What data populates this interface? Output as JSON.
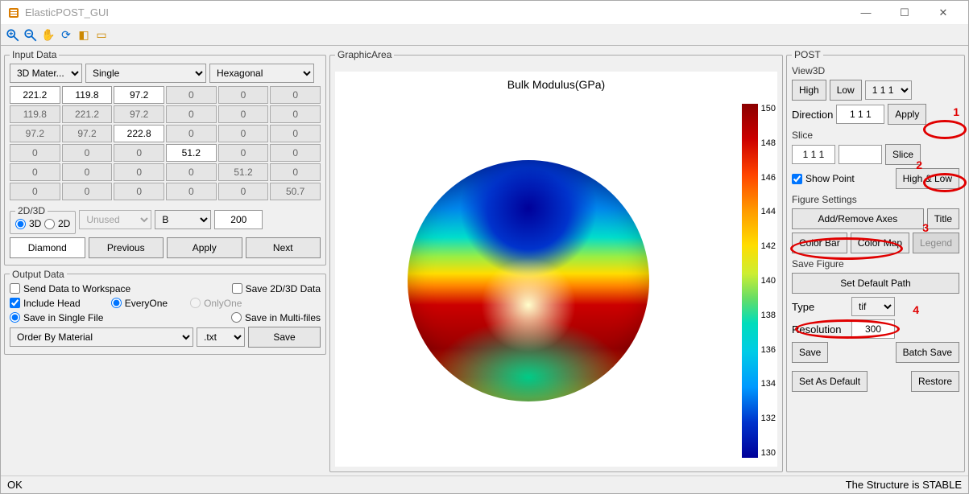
{
  "window": {
    "title": "ElasticPOST_GUI"
  },
  "input": {
    "legend": "Input Data",
    "selects": {
      "dim": "3D Mater...",
      "mode": "Single",
      "sym": "Hexagonal"
    },
    "matrix": [
      [
        {
          "v": "221.2",
          "e": true
        },
        {
          "v": "119.8",
          "e": true
        },
        {
          "v": "97.2",
          "e": true
        },
        {
          "v": "0",
          "e": false
        },
        {
          "v": "0",
          "e": false
        },
        {
          "v": "0",
          "e": false
        }
      ],
      [
        {
          "v": "119.8",
          "e": false
        },
        {
          "v": "221.2",
          "e": false
        },
        {
          "v": "97.2",
          "e": false
        },
        {
          "v": "0",
          "e": false
        },
        {
          "v": "0",
          "e": false
        },
        {
          "v": "0",
          "e": false
        }
      ],
      [
        {
          "v": "97.2",
          "e": false
        },
        {
          "v": "97.2",
          "e": false
        },
        {
          "v": "222.8",
          "e": true
        },
        {
          "v": "0",
          "e": false
        },
        {
          "v": "0",
          "e": false
        },
        {
          "v": "0",
          "e": false
        }
      ],
      [
        {
          "v": "0",
          "e": false
        },
        {
          "v": "0",
          "e": false
        },
        {
          "v": "0",
          "e": false
        },
        {
          "v": "51.2",
          "e": true
        },
        {
          "v": "0",
          "e": false
        },
        {
          "v": "0",
          "e": false
        }
      ],
      [
        {
          "v": "0",
          "e": false
        },
        {
          "v": "0",
          "e": false
        },
        {
          "v": "0",
          "e": false
        },
        {
          "v": "0",
          "e": false
        },
        {
          "v": "51.2",
          "e": false
        },
        {
          "v": "0",
          "e": false
        }
      ],
      [
        {
          "v": "0",
          "e": false
        },
        {
          "v": "0",
          "e": false
        },
        {
          "v": "0",
          "e": false
        },
        {
          "v": "0",
          "e": false
        },
        {
          "v": "0",
          "e": false
        },
        {
          "v": "50.7",
          "e": false
        }
      ]
    ],
    "d23d_legend": "2D/3D",
    "radio3d": "3D",
    "radio2d": "2D",
    "unused": "Unused",
    "prop": "B",
    "count": "200",
    "diamond": "Diamond",
    "previous": "Previous",
    "apply": "Apply",
    "next": "Next"
  },
  "output": {
    "legend": "Output Data",
    "send": "Send Data to Workspace",
    "save23": "Save 2D/3D Data",
    "include": "Include Head",
    "everyone": "EveryOne",
    "onlyone": "OnlyOne",
    "single": "Save in Single File",
    "multi": "Save in Multi-files",
    "order": "Order By Material",
    "ext": ".txt",
    "save": "Save"
  },
  "graphic": {
    "legend": "GraphicArea"
  },
  "chart_data": {
    "type": "heatmap",
    "title": "Bulk Modulus(GPa)",
    "colorbar_ticks": [
      "150",
      "148",
      "146",
      "144",
      "142",
      "140",
      "138",
      "136",
      "134",
      "132",
      "130"
    ],
    "colorbar_range": [
      130,
      150
    ],
    "description": "3D directional surface plot (sphere-like) colored by bulk modulus value; top pole ~130 GPa (blue), equatorial band ~148-150 GPa (red), belt of warm/yellow near lower-mid ~140-146 GPa"
  },
  "post": {
    "legend": "POST",
    "view3d": "View3D",
    "high": "High",
    "low": "Low",
    "dirsel": "1 1 1",
    "direction": "Direction",
    "dirval": "1 1 1",
    "apply": "Apply",
    "slice_h": "Slice",
    "sliceval": "1 1 1",
    "slice": "Slice",
    "showpoint": "Show Point",
    "highlow": "High & Low",
    "figset": "Figure Settings",
    "axes": "Add/Remove Axes",
    "title": "Title",
    "colorbar": "Color Bar",
    "colormap": "Color Map",
    "legend_btn": "Legend",
    "savefig": "Save Figure",
    "setdef": "Set Default Path",
    "type": "Type",
    "typesel": "tif",
    "res": "Resolution",
    "resval": "300",
    "save": "Save",
    "batch": "Batch Save",
    "setasdef": "Set As Default",
    "restore": "Restore"
  },
  "annots": {
    "n1": "1",
    "n2": "2",
    "n3": "3",
    "n4": "4"
  },
  "status": {
    "left": "OK",
    "right": "The Structure is STABLE"
  }
}
